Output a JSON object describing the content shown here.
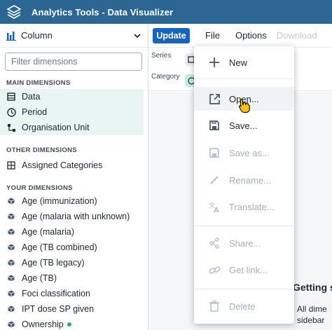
{
  "header": {
    "title": "Analytics Tools - Data Visualizer"
  },
  "toolbar": {
    "visualization_type": "Column",
    "update_label": "Update",
    "file_label": "File",
    "options_label": "Options",
    "download_label": "Download"
  },
  "sidebar": {
    "filter_placeholder": "Filter dimensions",
    "main_title": "MAIN DIMENSIONS",
    "main_items": [
      {
        "label": "Data",
        "icon": "database-icon"
      },
      {
        "label": "Period",
        "icon": "clock-icon"
      },
      {
        "label": "Organisation Unit",
        "icon": "hierarchy-icon"
      }
    ],
    "other_title": "OTHER DIMENSIONS",
    "other_items": [
      {
        "label": "Assigned Categories",
        "icon": "grid-icon"
      }
    ],
    "your_title": "YOUR DIMENSIONS",
    "your_items": [
      {
        "label": "Age (immunization)"
      },
      {
        "label": "Age (malaria with unknown)"
      },
      {
        "label": "Age (malaria)"
      },
      {
        "label": "Age (TB combined)"
      },
      {
        "label": "Age (TB legacy)"
      },
      {
        "label": "Age (TB)"
      },
      {
        "label": "Foci classification"
      },
      {
        "label": "IPT dose SP given"
      },
      {
        "label": "Ownership"
      }
    ]
  },
  "layout": {
    "series_label": "Series",
    "category_label": "Category"
  },
  "canvas": {
    "getting_started": "Getting s",
    "bullet_1": "All dime",
    "bullet_2": "sidebar"
  },
  "file_menu": {
    "items": [
      {
        "label": "New",
        "icon": "plus-icon",
        "enabled": true
      },
      {
        "label": "Open...",
        "icon": "open-external-icon",
        "enabled": true
      },
      {
        "label": "Save...",
        "icon": "save-icon",
        "enabled": true
      },
      {
        "label": "Save as...",
        "icon": "save-as-icon",
        "enabled": false
      },
      {
        "label": "Rename...",
        "icon": "pencil-icon",
        "enabled": false
      },
      {
        "label": "Translate...",
        "icon": "translate-icon",
        "enabled": false
      },
      {
        "label": "Share...",
        "icon": "share-icon",
        "enabled": false
      },
      {
        "label": "Get link...",
        "icon": "link-icon",
        "enabled": false
      },
      {
        "label": "Delete",
        "icon": "trash-icon",
        "enabled": false
      }
    ]
  },
  "colors": {
    "header_bg": "#2c6693",
    "primary_button": "#1565c0",
    "selected_dimension_bg": "#e8f5f3",
    "status_dot": "#3aa17e"
  }
}
